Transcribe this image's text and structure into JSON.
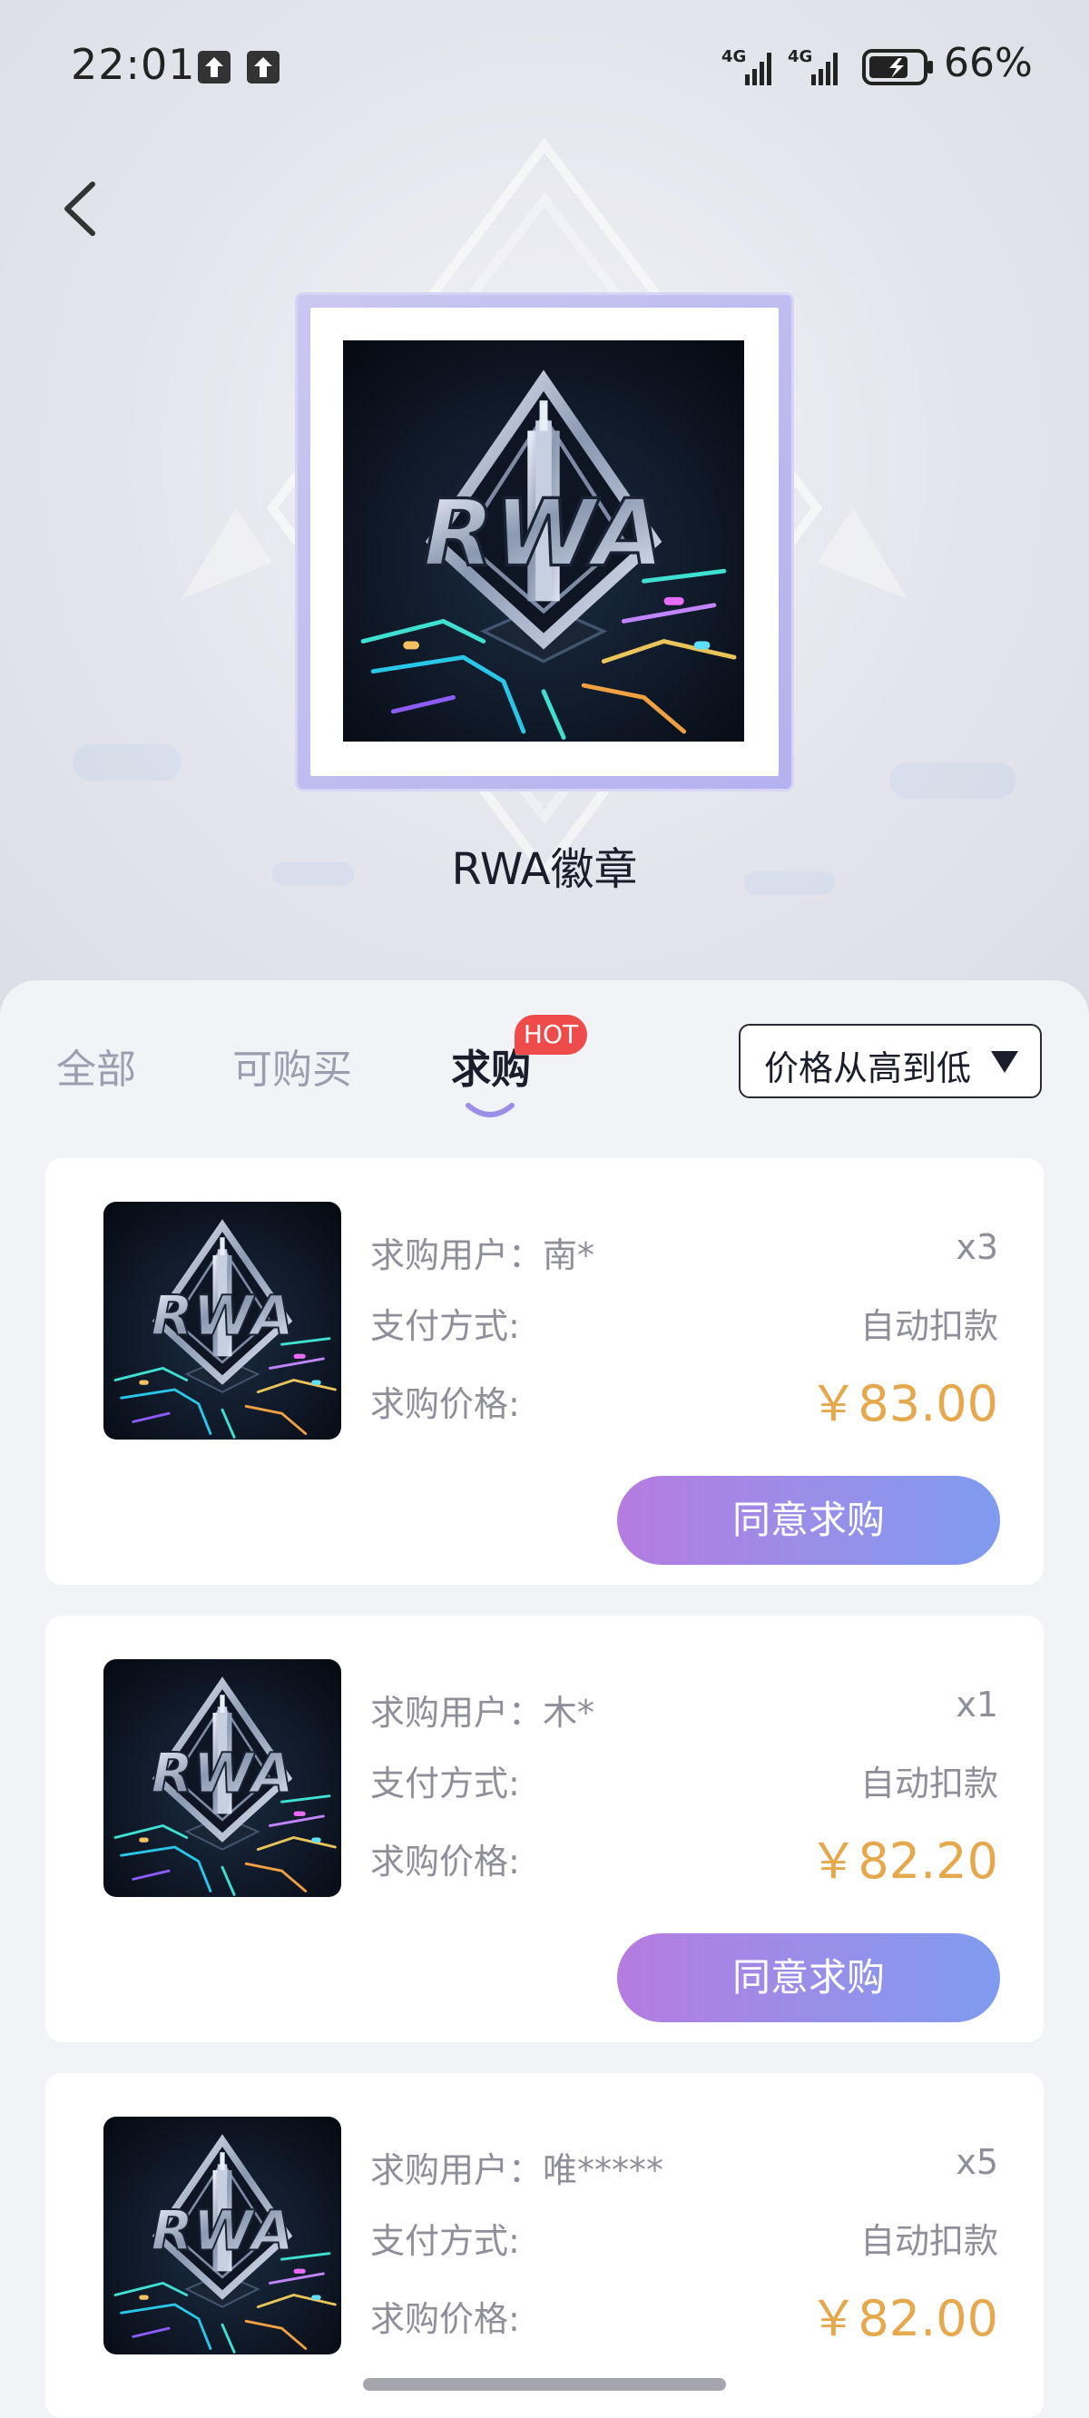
{
  "status_bar": {
    "time": "22:01",
    "battery_percent": "66%",
    "network_1": "4G",
    "network_2": "4G"
  },
  "header": {
    "badge_title": "RWA徽章",
    "badge_logo_text": "RWA"
  },
  "tabs": [
    {
      "label": "全部",
      "active": false
    },
    {
      "label": "可购买",
      "active": false
    },
    {
      "label": "求购",
      "active": true,
      "badge": "HOT"
    }
  ],
  "sort": {
    "label": "价格从高到低"
  },
  "field_labels": {
    "user": "求购用户：",
    "payment": "支付方式:",
    "price": "求购价格:"
  },
  "orders": [
    {
      "user": "南*",
      "quantity": "x3",
      "payment": "自动扣款",
      "price": "￥83.00",
      "button": "同意求购"
    },
    {
      "user": "木*",
      "quantity": "x1",
      "payment": "自动扣款",
      "price": "￥82.20",
      "button": "同意求购"
    },
    {
      "user": "唯*****",
      "quantity": "x5",
      "payment": "自动扣款",
      "price": "￥82.00",
      "button": "同意求购"
    }
  ],
  "colors": {
    "price": "#e6a84c",
    "button_gradient_start": "#b57be0",
    "button_gradient_end": "#7f9bef",
    "hot_badge": "#ef4b4b",
    "frame": "#b4b1ef"
  }
}
